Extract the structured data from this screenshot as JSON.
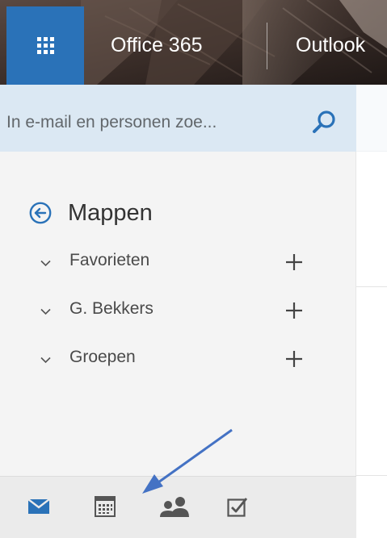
{
  "header": {
    "brand": "Office 365",
    "app_name": "Outlook",
    "waffle_icon": "app-launcher-icon",
    "accent_color": "#2a72b8"
  },
  "search": {
    "placeholder": "In e-mail en personen zoe...",
    "value": "",
    "icon": "search-icon",
    "band_color": "#dbe8f3"
  },
  "folders_pane": {
    "title": "Mappen",
    "back_icon": "back-arrow-circle-icon",
    "groups": [
      {
        "label": "Favorieten",
        "expand_icon": "chevron-down-icon",
        "add_icon": "plus-icon"
      },
      {
        "label": "G. Bekkers",
        "expand_icon": "chevron-down-icon",
        "add_icon": "plus-icon"
      },
      {
        "label": "Groepen",
        "expand_icon": "chevron-down-icon",
        "add_icon": "plus-icon"
      }
    ]
  },
  "modules": [
    {
      "name": "mail",
      "icon": "mail-icon",
      "active": true
    },
    {
      "name": "calendar",
      "icon": "calendar-icon",
      "active": false
    },
    {
      "name": "people",
      "icon": "people-icon",
      "active": false
    },
    {
      "name": "tasks",
      "icon": "tasks-checkbox-icon",
      "active": false
    }
  ],
  "annotation": {
    "type": "arrow",
    "color": "#4472c4",
    "points_to": "calendar-icon"
  }
}
